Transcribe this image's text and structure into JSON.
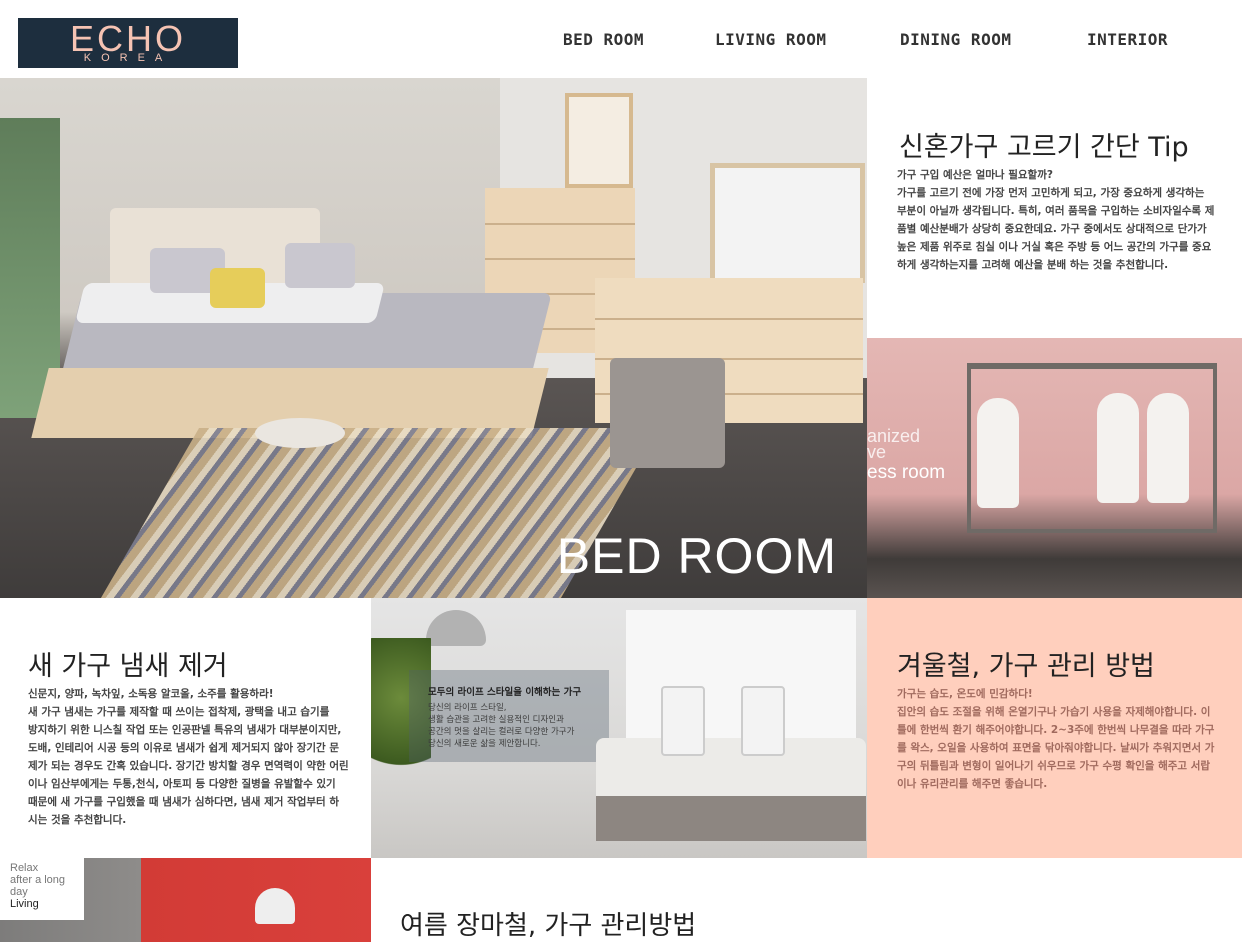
{
  "brand": {
    "name": "ECHO",
    "sub": "KOREA",
    "bg": "#1d2e3e",
    "fg": "#f5c3b3"
  },
  "nav": [
    "BED ROOM",
    "LIVING ROOM",
    "DINING ROOM",
    "INTERIOR"
  ],
  "hero": {
    "label": "BED ROOM"
  },
  "tip1": {
    "title": "신혼가구 고르기 간단 Tip",
    "lines": [
      "가구 구입 예산은 얼마나 필요할까?",
      "가구를 고르기 전에 가장 먼저 고민하게 되고, 가장 중요하게 생각하는",
      "부분이 아닐까 생각됩니다. 특히, 여러 품목을 구입하는 소비자일수록 제",
      "품별 예산분배가 상당히 중요한데요. 가구 중에서도 상대적으로 단가가",
      "높은 제품 위주로 침실 이나 거실 혹은 주방 등 어느 공간의 가구를 중요",
      "하게 생각하는지를 고려해 예산을 분배 하는 것을 추천합니다."
    ]
  },
  "dressroom": {
    "text1": "anized",
    "text2": "ve",
    "text3": "ess room"
  },
  "tip2": {
    "title": "새 가구 냄새 제거",
    "lines": [
      "신문지, 양파, 녹차잎, 소독용 알코올, 소주를 활용하라!",
      "새 가구 냄새는 가구를 제작할 때 쓰이는 접착제, 광택을 내고 습기를",
      "방지하기 위한 니스칠 작업 또는 인공판넬 특유의 냄새가 대부분이지만,",
      "도배, 인테리어 시공 등의 이유로 냄새가 쉽게 제거되지 않아 장기간 문",
      "제가 되는 경우도 간혹 있습니다. 장기간 방치할 경우 면역력이 약한 어린",
      "이나 임산부에게는 두통,천식, 아토피 등 다양한 질병을 유발할수 있기",
      "때문에 새 가구를 구입했을 때 냄새가 심하다면, 냄새 제거 작업부터 하",
      "시는 것을 추천합니다."
    ]
  },
  "living_caption": {
    "title": "모두의 라이프 스타일을 이해하는 가구",
    "lines": [
      "당신의 라이프 스타일,",
      "생활 습관을 고려한 실용적인 디자인과",
      "공간의 멋을 살리는 컬러로 다양한 가구가",
      "당신의 새로운 삶을 제안합니다."
    ]
  },
  "tip3": {
    "title": "겨울철, 가구 관리 방법",
    "bg": "#ffcfbd",
    "lines": [
      "가구는 습도, 온도에 민감하다!",
      "집안의 습도 조절을 위해 온열기구나 가습기 사용을 자제해야합니다. 이",
      "틀에 한번씩 환기 해주어야합니다. 2~3주에 한번씩 나무결을 따라 가구",
      "를 왁스, 오일을 사용하여 표면을 닦아줘야합니다. 날씨가 추워지면서 가",
      "구의 뒤틀림과 변형이 일어나기 쉬우므로 가구 수평 확인을 해주고 서랍",
      "이나 유리관리를 해주면 좋습니다."
    ]
  },
  "relax": {
    "line1": "Relax",
    "line2": "after a long day",
    "line3": "Living"
  },
  "tip4": {
    "title": "여름 장마철, 가구 관리방법"
  }
}
